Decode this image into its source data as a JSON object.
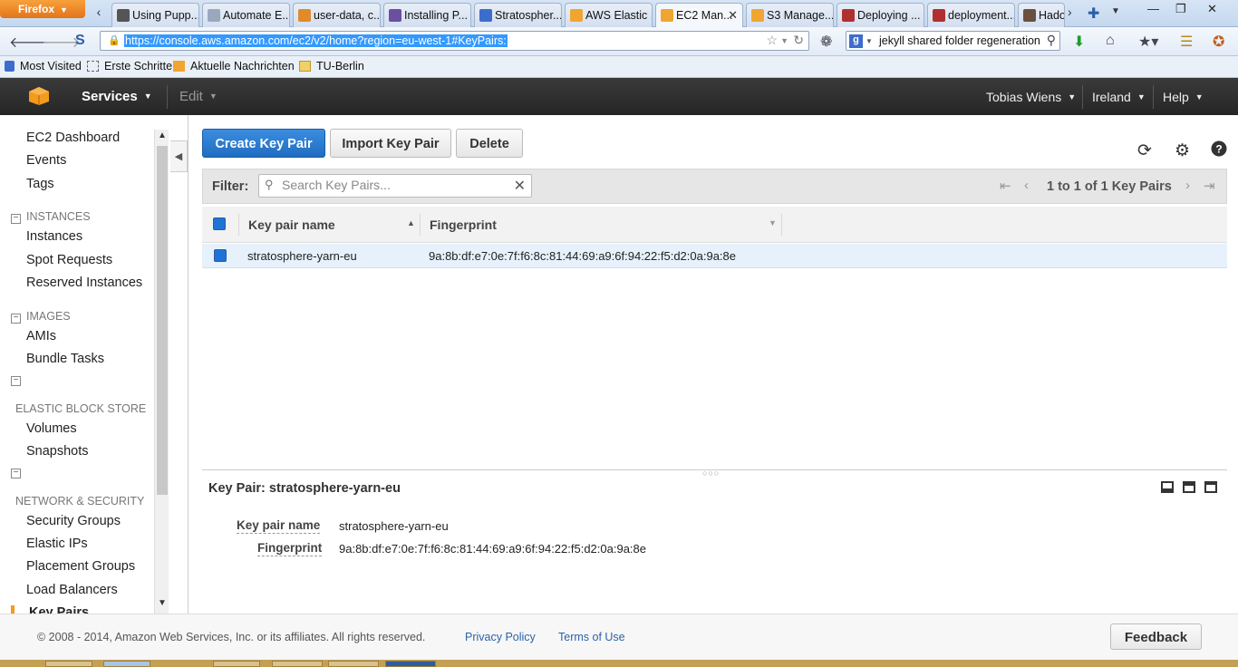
{
  "browser": {
    "menu_label": "Firefox",
    "tabs": [
      {
        "title": "Using Pupp...",
        "icon_color": "#555555"
      },
      {
        "title": "Automate E...",
        "icon_color": "#9aa8bd"
      },
      {
        "title": "user-data, c...",
        "icon_color": "#e08a2a"
      },
      {
        "title": "Installing P...",
        "icon_color": "#6b4fa0"
      },
      {
        "title": "Stratospher...",
        "icon_color": "#3d6dcc"
      },
      {
        "title": "AWS Elastic ...",
        "icon_color": "#f0a530"
      },
      {
        "title": "EC2 Man...",
        "icon_color": "#f0a530"
      },
      {
        "title": "S3 Manage...",
        "icon_color": "#f0a530"
      },
      {
        "title": "Deploying ...",
        "icon_color": "#b03030"
      },
      {
        "title": "deployment...",
        "icon_color": "#b03030"
      },
      {
        "title": "Hado",
        "icon_color": "#6b5040"
      }
    ],
    "address": "https://console.aws.amazon.com/ec2/v2/home?region=eu-west-1#KeyPairs:",
    "search_query": "jekyll shared folder regeneration",
    "bookmarks": [
      "Most Visited",
      "Erste Schritte",
      "Aktuelle Nachrichten",
      "TU-Berlin"
    ]
  },
  "aws_header": {
    "services_label": "Services",
    "edit_label": "Edit",
    "user_label": "Tobias Wiens",
    "region_label": "Ireland",
    "help_label": "Help"
  },
  "sidebar": {
    "top_items": [
      "EC2 Dashboard",
      "Events",
      "Tags"
    ],
    "sections": {
      "instances": {
        "title": "INSTANCES",
        "items": [
          "Instances",
          "Spot Requests",
          "Reserved Instances"
        ]
      },
      "images": {
        "title": "IMAGES",
        "items": [
          "AMIs",
          "Bundle Tasks"
        ]
      },
      "ebs": {
        "title": "ELASTIC BLOCK STORE",
        "items": [
          "Volumes",
          "Snapshots"
        ]
      },
      "network": {
        "title": "NETWORK & SECURITY",
        "items": [
          "Security Groups",
          "Elastic IPs",
          "Placement Groups",
          "Load Balancers",
          "Key Pairs"
        ]
      }
    }
  },
  "toolbar": {
    "create_label": "Create Key Pair",
    "import_label": "Import Key Pair",
    "delete_label": "Delete"
  },
  "filter": {
    "label": "Filter:",
    "placeholder": "Search Key Pairs...",
    "pager_text": "1 to 1 of 1 Key Pairs"
  },
  "table": {
    "columns": [
      "Key pair name",
      "Fingerprint"
    ],
    "rows": [
      {
        "name": "stratosphere-yarn-eu",
        "fingerprint": "9a:8b:df:e7:0e:7f:f6:8c:81:44:69:a9:6f:94:22:f5:d2:0a:9a:8e"
      }
    ]
  },
  "detail": {
    "title": "Key Pair: stratosphere-yarn-eu",
    "name_label": "Key pair name",
    "name_value": "stratosphere-yarn-eu",
    "fingerprint_label": "Fingerprint",
    "fingerprint_value": "9a:8b:df:e7:0e:7f:f6:8c:81:44:69:a9:6f:94:22:f5:d2:0a:9a:8e"
  },
  "footer": {
    "copyright": "© 2008 - 2014, Amazon Web Services, Inc. or its affiliates. All rights reserved.",
    "privacy_label": "Privacy Policy",
    "terms_label": "Terms of Use",
    "feedback_label": "Feedback"
  },
  "colors": {
    "accent_blue": "#1f6dc1",
    "aws_header": "#2f2f2f",
    "aws_orange": "#f29b1d",
    "selected_row": "#e6f1fb"
  }
}
